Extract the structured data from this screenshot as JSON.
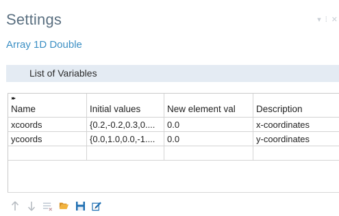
{
  "header": {
    "title": "Settings",
    "subtitle": "Array 1D Double"
  },
  "section": {
    "label": "List of Variables"
  },
  "table": {
    "expand_glyph": "▸▸",
    "columns": [
      "Name",
      "Initial values",
      "New element val",
      "Description"
    ],
    "rows": [
      [
        "xcoords",
        "{0.2,-0.2,0.3,0....",
        "0.0",
        "x-coordinates"
      ],
      [
        "ycoords",
        "{0.0,1.0,0.0,-1....",
        "0.0",
        "y-coordinates"
      ],
      [
        "",
        "",
        "",
        ""
      ]
    ]
  },
  "toolbar": {
    "icons": [
      "move-up-icon",
      "move-down-icon",
      "clear-table-icon",
      "open-folder-icon",
      "save-icon",
      "edit-icon"
    ]
  },
  "colors": {
    "title": "#5a6f80",
    "subtitle": "#3b8fc4",
    "section_bg": "#e4ebf3",
    "icon_blue": "#1f6fb2",
    "icon_folder": "#e9a02b"
  }
}
